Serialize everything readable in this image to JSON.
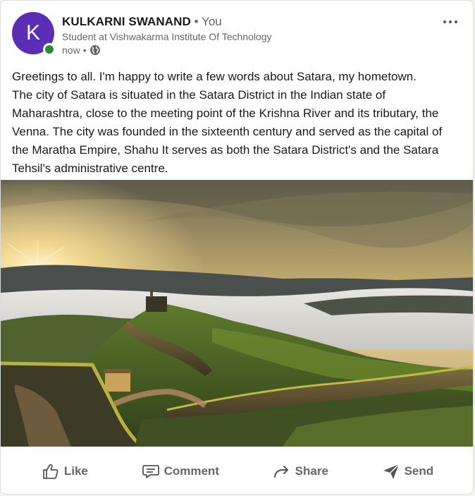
{
  "author": {
    "avatar_letter": "K",
    "name": "KULKARNI SWANAND",
    "separator": "•",
    "relation": "You",
    "headline": "Student at Vishwakarma Institute Of Technology",
    "time": "now",
    "time_separator": "•",
    "visibility_icon": "globe-icon",
    "online_status_color": "#2e8a3a",
    "avatar_color": "#5b2fb5"
  },
  "post": {
    "lines": [
      "Greetings to all. I'm happy to write a few words about Satara, my hometown.",
      "The city of Satara is situated in the Satara District in the Indian state of",
      "Maharashtra, close to the meeting point of the Krishna River and its tributary, the",
      "Venna. The city was founded in the sixteenth century and served as the capital of",
      "the Maratha Empire, Shahu It serves as both the Satara District's and the Satara",
      "Tehsil's administrative centre."
    ],
    "image_description_icon": "landscape-photo"
  },
  "actions": {
    "like": "Like",
    "comment": "Comment",
    "share": "Share",
    "send": "Send"
  }
}
